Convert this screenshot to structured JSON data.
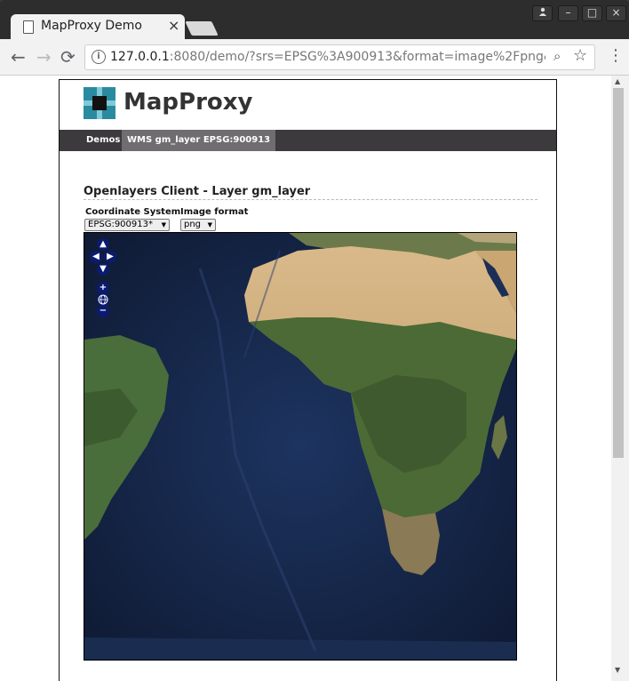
{
  "browser": {
    "tab_title": "MapProxy Demo",
    "url_host": "127.0.0.1",
    "url_rest": ":8080/demo/?srs=EPSG%3A900913&format=image%2Fpng&wms_lay"
  },
  "site": {
    "brand": "MapProxy",
    "nav": [
      "Demos",
      "WMS gm_layer EPSG:900913"
    ]
  },
  "content": {
    "heading": "Openlayers Client - Layer gm_layer",
    "coord_label": "Coordinate System",
    "coord_value": "EPSG:900913*",
    "format_label": "Image format",
    "format_value": "png"
  },
  "colors": {
    "ocean": "#13203a",
    "navbar": "#3d3a3d",
    "brand_teal": "#2a8aa0"
  },
  "icons": {
    "pan": [
      "up",
      "left",
      "right",
      "down"
    ],
    "zoom": [
      "zoom-in",
      "world",
      "zoom-out"
    ]
  }
}
